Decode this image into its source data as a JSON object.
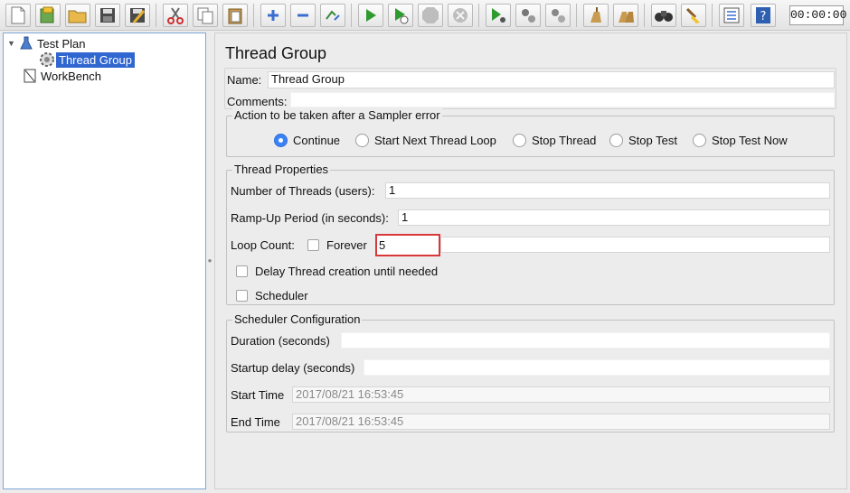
{
  "toolbar": {
    "icons": [
      "new-icon",
      "templates-icon",
      "open-icon",
      "save-icon",
      "save-as-icon",
      "cut-icon",
      "copy-icon",
      "paste-icon",
      "expand-icon",
      "collapse-icon",
      "toggle-icon",
      "start-icon",
      "start-no-timers-icon",
      "stop-icon",
      "shutdown-icon",
      "remote-start-icon",
      "remote-stop-icon",
      "remote-shutdown-icon",
      "clear-icon",
      "clear-all-icon",
      "search-icon",
      "reset-search-icon",
      "function-helper-icon",
      "help-icon"
    ],
    "timer": "00:00:00"
  },
  "tree": {
    "items": [
      {
        "label": "Test Plan",
        "icon": "test-plan-icon"
      },
      {
        "label": "Thread Group",
        "icon": "thread-group-icon",
        "selected": true
      },
      {
        "label": "WorkBench",
        "icon": "workbench-icon"
      }
    ]
  },
  "main": {
    "title": "Thread Group",
    "name_label": "Name:",
    "name_value": "Thread Group",
    "comments_label": "Comments:",
    "comments_value": "",
    "sampler_error": {
      "legend": "Action to be taken after a Sampler error",
      "options": [
        "Continue",
        "Start Next Thread Loop",
        "Stop Thread",
        "Stop Test",
        "Stop Test Now"
      ],
      "selected": "Continue"
    },
    "thread_props": {
      "legend": "Thread Properties",
      "threads_label": "Number of Threads (users):",
      "threads_value": "1",
      "rampup_label": "Ramp-Up Period (in seconds):",
      "rampup_value": "1",
      "loop_label": "Loop Count:",
      "forever_label": "Forever",
      "forever_checked": false,
      "loop_value": "5",
      "delay_label": "Delay Thread creation until needed",
      "delay_checked": false,
      "scheduler_label": "Scheduler",
      "scheduler_checked": false
    },
    "scheduler_config": {
      "legend": "Scheduler Configuration",
      "duration_label": "Duration (seconds)",
      "duration_value": "",
      "startup_label": "Startup delay (seconds)",
      "startup_value": "",
      "start_label": "Start Time",
      "start_value": "2017/08/21 16:53:45",
      "end_label": "End Time",
      "end_value": "2017/08/21 16:53:45"
    }
  },
  "colors": {
    "selection": "#2f66d0",
    "radio_checked": "#3a82f7",
    "highlight_border": "#d9383a",
    "tree_border": "#7ea6d8"
  }
}
